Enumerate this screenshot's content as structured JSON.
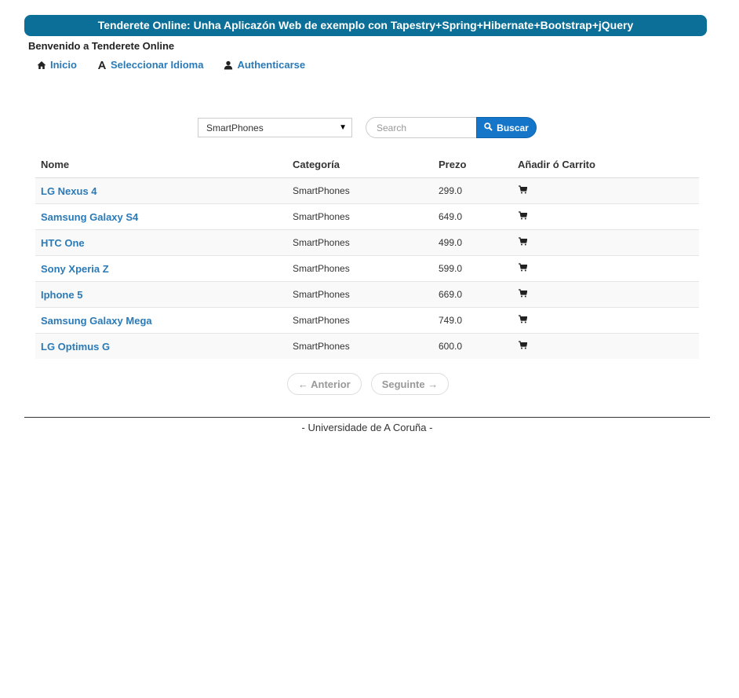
{
  "header": {
    "banner_title": "Tenderete Online: Unha Aplicazón Web de exemplo con Tapestry+Spring+Hibernate+Bootstrap+jQuery",
    "welcome": "Benvenido a Tenderete Online"
  },
  "nav": {
    "items": [
      {
        "label": "Inicio",
        "icon": "home-icon"
      },
      {
        "label": "Seleccionar Idioma",
        "icon": "font-icon"
      },
      {
        "label": "Authenticarse",
        "icon": "user-icon"
      }
    ]
  },
  "search": {
    "category_selected": "SmartPhones",
    "placeholder": "Search",
    "button_label": "Buscar"
  },
  "table": {
    "headers": {
      "name": "Nome",
      "category": "Categoría",
      "price": "Prezo",
      "cart": "Añadir ó Carrito"
    },
    "rows": [
      {
        "name": "LG Nexus 4",
        "category": "SmartPhones",
        "price": "299.0"
      },
      {
        "name": "Samsung Galaxy S4",
        "category": "SmartPhones",
        "price": "649.0"
      },
      {
        "name": "HTC One",
        "category": "SmartPhones",
        "price": "499.0"
      },
      {
        "name": "Sony Xperia Z",
        "category": "SmartPhones",
        "price": "599.0"
      },
      {
        "name": "Iphone 5",
        "category": "SmartPhones",
        "price": "669.0"
      },
      {
        "name": "Samsung Galaxy Mega",
        "category": "SmartPhones",
        "price": "749.0"
      },
      {
        "name": "LG Optimus G",
        "category": "SmartPhones",
        "price": "600.0"
      }
    ]
  },
  "pager": {
    "previous_label": "← Anterior",
    "next_label": "Seguinte →"
  },
  "footer": {
    "text": "- Universidade de A Coruña -"
  },
  "colors": {
    "banner": "#0b6f97",
    "link": "#2a7ab8",
    "button": "#1576c9"
  }
}
